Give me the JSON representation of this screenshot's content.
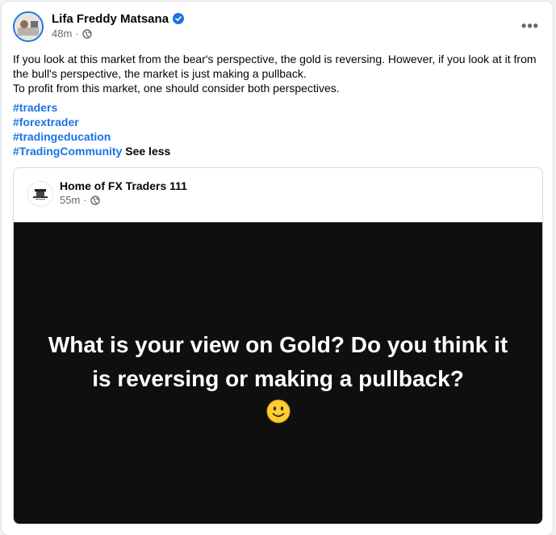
{
  "post": {
    "author": "Lifa Freddy Matsana",
    "time": "48m",
    "meta_separator": "·",
    "more_label": "•••",
    "text_lines": [
      "If you look at this market from the bear's perspective, the gold is reversing. However, if you look at it from the bull's perspective, the market is just making a pullback.",
      "To profit from this market, one should consider both perspectives."
    ],
    "hashtags": [
      "#traders",
      "#forextrader",
      "#tradingeducation",
      "#TradingCommunity"
    ],
    "see_less_label": "See less"
  },
  "shared_post": {
    "page_name": "Home of FX Traders 111",
    "time": "55m",
    "meta_separator": "·",
    "image_text": "What is your view on Gold? Do you think it is reversing or making a pullback?"
  },
  "colors": {
    "link_blue": "#1b74e4",
    "secondary_text": "#65676b",
    "card_background": "#0f0f0f"
  }
}
